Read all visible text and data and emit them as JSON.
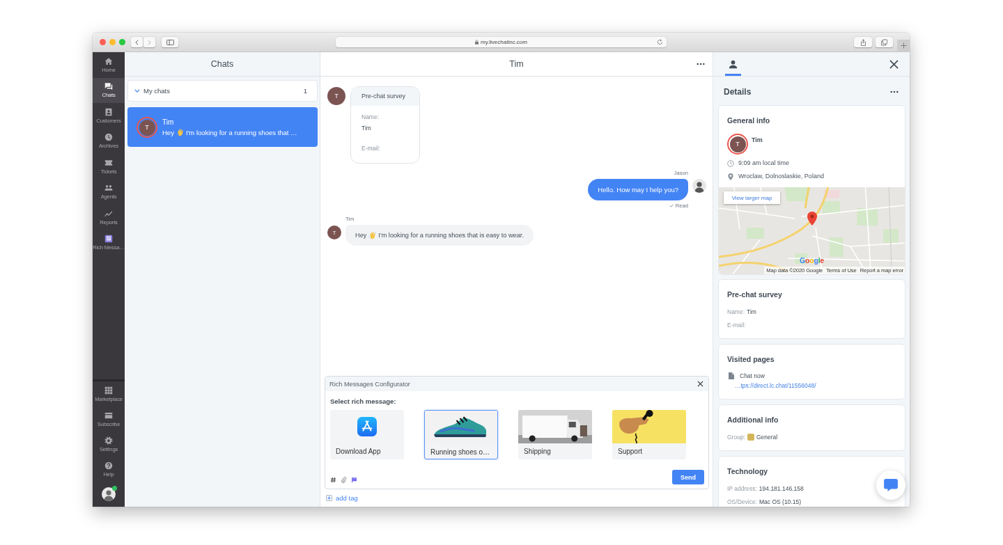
{
  "browser": {
    "url": "my.livechatinc.com"
  },
  "nav": {
    "items": [
      {
        "label": "Home",
        "selected": false
      },
      {
        "label": "Chats",
        "selected": true
      },
      {
        "label": "Customers",
        "selected": false
      },
      {
        "label": "Archives",
        "selected": false
      },
      {
        "label": "Tickets",
        "selected": false
      },
      {
        "label": "Agents",
        "selected": false
      },
      {
        "label": "Reports",
        "selected": false
      },
      {
        "label": "Rich Messa…",
        "selected": false
      }
    ],
    "bottom_items": [
      {
        "label": "Marketplace"
      },
      {
        "label": "Subscribe"
      },
      {
        "label": "Settings"
      },
      {
        "label": "Help"
      }
    ],
    "profile": {
      "online": true
    }
  },
  "chats_panel": {
    "title": "Chats",
    "group": {
      "label": "My chats",
      "count": "1",
      "expanded": true
    },
    "chats": [
      {
        "name": "Tim",
        "initial": "T",
        "preview_start": "Hey",
        "preview_end": "I'm looking for a running shoes that …",
        "selected": true
      }
    ]
  },
  "conversation": {
    "title": "Tim",
    "messages": [
      {
        "kind": "survey",
        "initial": "T",
        "title": "Pre-chat survey",
        "fields": [
          {
            "label": "Name:",
            "value": "Tim"
          },
          {
            "label": "E-mail:"
          }
        ]
      },
      {
        "kind": "agent",
        "author": "Jason",
        "text": "Hello. How may I help you?",
        "status": "Read"
      },
      {
        "kind": "customer",
        "author": "Tim",
        "initial": "T",
        "text_start": "Hey",
        "text_end": "I'm looking for a running shoes that is easy to wear."
      }
    ]
  },
  "composer": {
    "configurator": {
      "title": "Rich Messages Configurator",
      "prompt": "Select rich message:",
      "cards": [
        {
          "kind": "app",
          "label": "Download App",
          "selected": false
        },
        {
          "kind": "shoe",
          "label": "Running shoes o…",
          "selected": true
        },
        {
          "kind": "van",
          "label": "Shipping",
          "selected": false
        },
        {
          "kind": "phone",
          "label": "Support",
          "selected": false
        }
      ]
    },
    "send_label": "Send",
    "add_tag": "add tag"
  },
  "details": {
    "tab": {
      "selected": true
    },
    "title": "Details",
    "general": {
      "title": "General info",
      "name": "Tim",
      "initial": "T",
      "local_time": "9:09 am local time",
      "location": "Wroclaw, Dolnoslaskie, Poland",
      "map": {
        "button": "View larger map",
        "logo": "Google",
        "footer": [
          "Map data ©2020 Google",
          "Terms of Use",
          "Report a map error"
        ]
      }
    },
    "survey": {
      "title": "Pre-chat survey",
      "fields": [
        {
          "label": "Name:",
          "value": "Tim"
        },
        {
          "label": "E-mail:"
        }
      ]
    },
    "visited": {
      "title": "Visited pages",
      "pages": [
        {
          "title": "Chat now",
          "url": "…tps://direct.lc.chat/11556048/"
        }
      ]
    },
    "additional": {
      "title": "Additional info",
      "fields": [
        {
          "label": "Group:",
          "value": "General",
          "color": "#d4b65a"
        }
      ]
    },
    "technology": {
      "title": "Technology",
      "fields": [
        {
          "label": "IP address:",
          "value": "194.181.146.158"
        },
        {
          "label": "OS/Device:",
          "value": "Mac OS (10.15)"
        }
      ]
    }
  }
}
